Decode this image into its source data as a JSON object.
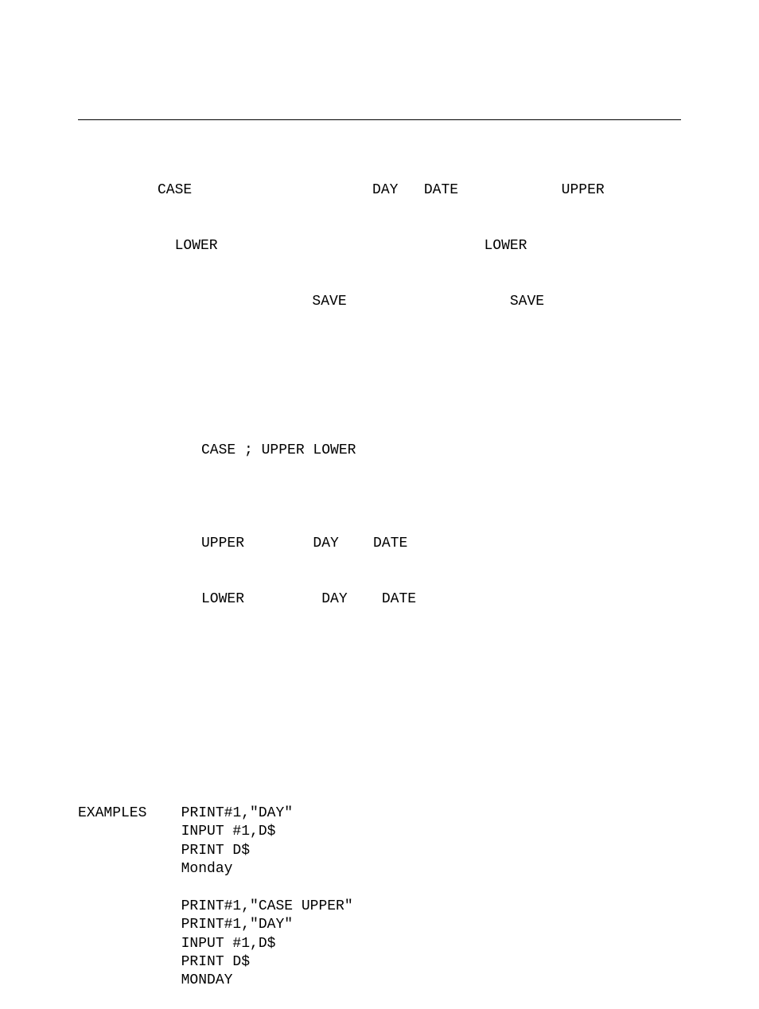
{
  "para1": {
    "line1": "CASE                     DAY   DATE            UPPER",
    "line2": "  LOWER                               LOWER",
    "line3": "                  SAVE                   SAVE"
  },
  "format": {
    "line1": "CASE ; UPPER LOWER",
    "line2": "",
    "line3": "UPPER        DAY    DATE",
    "line4": "LOWER         DAY    DATE"
  },
  "examples": {
    "label": "EXAMPLES",
    "block1": {
      "l1": "PRINT#1,\"DAY\"",
      "l2": "INPUT #1,D$",
      "l3": "PRINT D$",
      "l4": "Monday"
    },
    "block2": {
      "l1": "PRINT#1,\"CASE UPPER\"",
      "l2": "PRINT#1,\"DAY\"",
      "l3": "INPUT #1,D$",
      "l4": "PRINT D$",
      "l5": "MONDAY"
    }
  }
}
